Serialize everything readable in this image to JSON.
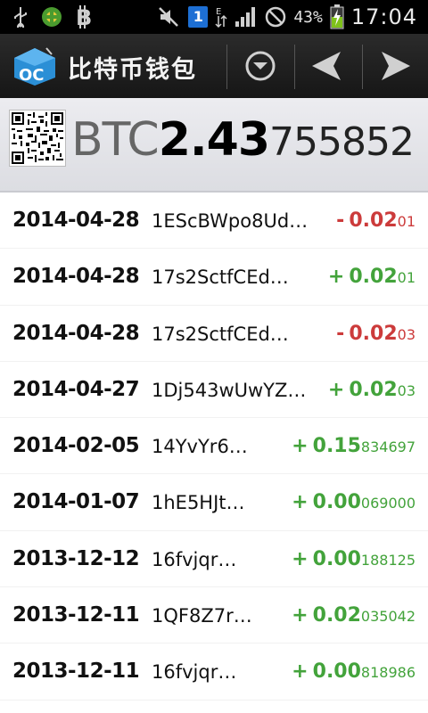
{
  "status_bar": {
    "battery_percent": "43%",
    "time": "17:04",
    "badge": "1",
    "icons": [
      "usb-icon",
      "green-app-icon",
      "bitcoin-icon",
      "mute-icon",
      "notification-badge-icon",
      "data-arrows-icon",
      "signal-icon",
      "no-sim-icon",
      "battery-icon"
    ]
  },
  "action_bar": {
    "title": "比特币钱包",
    "logo_text": "OC",
    "buttons": [
      "dropdown-icon",
      "back-arrow-icon",
      "send-arrow-icon"
    ]
  },
  "balance": {
    "unit": "BTC",
    "big": "2.43",
    "small": "755852"
  },
  "transactions": [
    {
      "date": "2014-04-28",
      "address": "1EScBWpo8Ud…",
      "sign": "-",
      "big": "0.02",
      "small": "01",
      "direction": "neg"
    },
    {
      "date": "2014-04-28",
      "address": "17s2SctfCEd…",
      "sign": "+",
      "big": "0.02",
      "small": "01",
      "direction": "pos"
    },
    {
      "date": "2014-04-28",
      "address": "17s2SctfCEd…",
      "sign": "-",
      "big": "0.02",
      "small": "03",
      "direction": "neg"
    },
    {
      "date": "2014-04-27",
      "address": "1Dj543wUwYZ…",
      "sign": "+",
      "big": "0.02",
      "small": "03",
      "direction": "pos"
    },
    {
      "date": "2014-02-05",
      "address": "14YvYr6…",
      "sign": "+",
      "big": "0.15",
      "small": "834697",
      "direction": "pos"
    },
    {
      "date": "2014-01-07",
      "address": "1hE5HJt…",
      "sign": "+",
      "big": "0.00",
      "small": "069000",
      "direction": "pos"
    },
    {
      "date": "2013-12-12",
      "address": "16fvjqr…",
      "sign": "+",
      "big": "0.00",
      "small": "188125",
      "direction": "pos"
    },
    {
      "date": "2013-12-11",
      "address": "1QF8Z7r…",
      "sign": "+",
      "big": "0.02",
      "small": "035042",
      "direction": "pos"
    },
    {
      "date": "2013-12-11",
      "address": "16fvjqr…",
      "sign": "+",
      "big": "0.00",
      "small": "818986",
      "direction": "pos"
    }
  ],
  "colors": {
    "negative": "#cc3b3b",
    "positive": "#43a33b",
    "action_bar": "#1f1f1f",
    "logo": "#2b8fd6"
  }
}
